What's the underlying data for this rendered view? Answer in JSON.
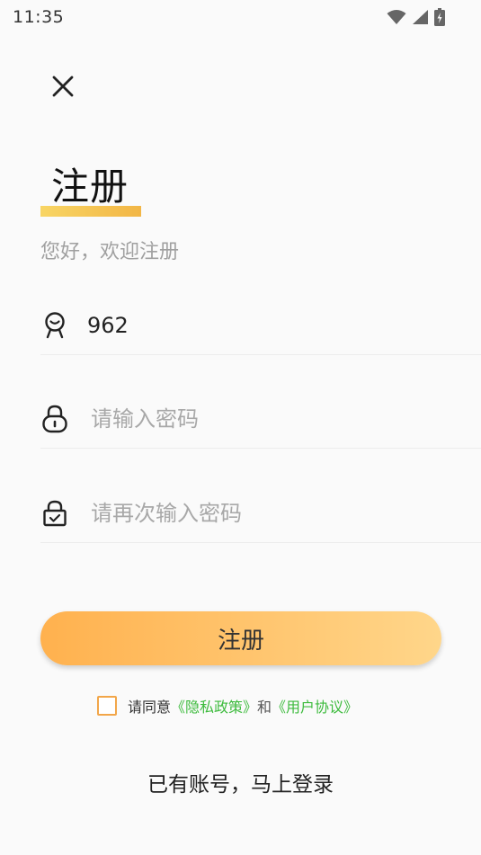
{
  "status_bar": {
    "time": "11:35",
    "icons": [
      "wifi-icon",
      "cellular-signal-icon",
      "battery-charging-icon"
    ]
  },
  "header": {
    "close_icon": "close-icon"
  },
  "title": {
    "text": "注册",
    "underline_color": "#f2b646"
  },
  "subtitle": "您好，欢迎注册",
  "form": {
    "account": {
      "icon": "user-badge-icon",
      "value": "962"
    },
    "password": {
      "icon": "lock-icon",
      "placeholder": "请输入密码"
    },
    "confirm_password": {
      "icon": "lock-check-icon",
      "placeholder": "请再次输入密码"
    },
    "submit_label": "注册"
  },
  "agreement": {
    "checked": false,
    "prefix": "请同意",
    "privacy_link": "《隐私政策》",
    "connector": "和",
    "terms_link": "《用户协议》",
    "link_color": "#3dbb3d"
  },
  "login_link": "已有账号，马上登录",
  "colors": {
    "accent_start": "#ffb14e",
    "accent_end": "#ffd68a",
    "checkbox_border": "#f2a649"
  }
}
